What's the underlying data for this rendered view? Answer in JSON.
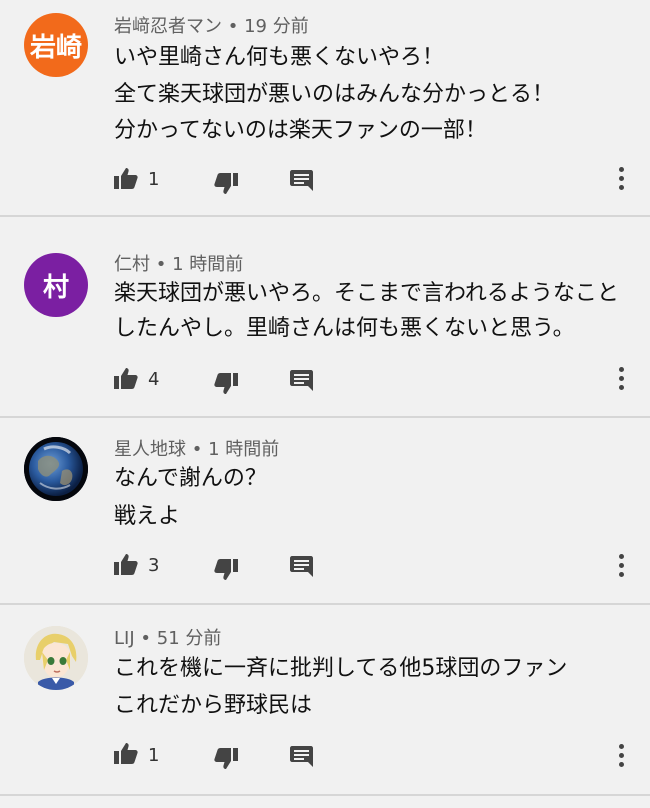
{
  "comments": [
    {
      "avatar_text": "岩崎",
      "avatar_color": "#f26a1b",
      "author": "岩﨑忍者マン",
      "separator": "•",
      "time": "19 分前",
      "lines": [
        "いや里崎さん何も悪くないやろ！",
        "全て楽天球団が悪いのはみんな分かっとる！",
        "分かってないのは楽天ファンの一部！"
      ],
      "likes": "1"
    },
    {
      "avatar_text": "村",
      "avatar_color": "#7b1fa2",
      "author": "仁村",
      "separator": "•",
      "time": "1 時間前",
      "lines": [
        "楽天球団が悪いやろ。そこまで言われるようなこと",
        "したんやし。里崎さんは何も悪くないと思う。"
      ],
      "likes": "4"
    },
    {
      "avatar_text": "",
      "avatar_color": "#1b3a6b",
      "author": "星人地球",
      "separator": "•",
      "time": "1 時間前",
      "lines": [
        "なんで謝んの？",
        "戦えよ"
      ],
      "likes": "3"
    },
    {
      "avatar_text": "",
      "avatar_color": "#e9e3d3",
      "author": "LIJ",
      "separator": "•",
      "time": "51 分前",
      "lines": [
        "これを機に一斉に批判してる他5球団のファン",
        "これだから野球民は"
      ],
      "likes": "1"
    }
  ],
  "icons": {
    "like": "thumbs-up-icon",
    "dislike": "thumbs-down-icon",
    "reply": "reply-comment-icon",
    "more": "more-vertical-icon"
  },
  "colors": {
    "background": "#f1f1f1",
    "divider": "#d6d6d6",
    "meta_text": "#606060",
    "icon": "#444444"
  }
}
